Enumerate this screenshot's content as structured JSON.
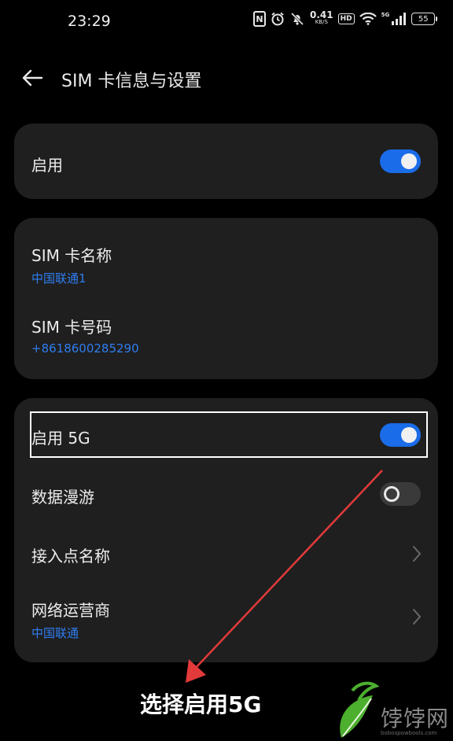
{
  "status_bar": {
    "time": "23:29",
    "nfc_label": "N",
    "speed_value": "0.41",
    "speed_unit": "KB/S",
    "hd_label": "HD",
    "network_label": "5G",
    "battery_level": "55"
  },
  "header": {
    "title": "SIM 卡信息与设置"
  },
  "card_enable": {
    "label": "启用",
    "enabled": true
  },
  "card_sim": {
    "name_label": "SIM 卡名称",
    "name_value": "中国联通1",
    "number_label": "SIM 卡号码",
    "number_value": "+8618600285290"
  },
  "card_network": {
    "enable_5g_label": "启用 5G",
    "enable_5g_on": true,
    "roaming_label": "数据漫游",
    "roaming_on": false,
    "apn_label": "接入点名称",
    "operator_label": "网络运营商",
    "operator_value": "中国联通"
  },
  "annotation": {
    "text": "选择启用5G"
  },
  "watermark": {
    "text": "饽饽网",
    "sub": "bobospowbools.com"
  },
  "colors": {
    "accent": "#1a6ce8",
    "link": "#2f7df1",
    "card_bg": "#1f1f1f",
    "arrow": "#e23a3a"
  }
}
